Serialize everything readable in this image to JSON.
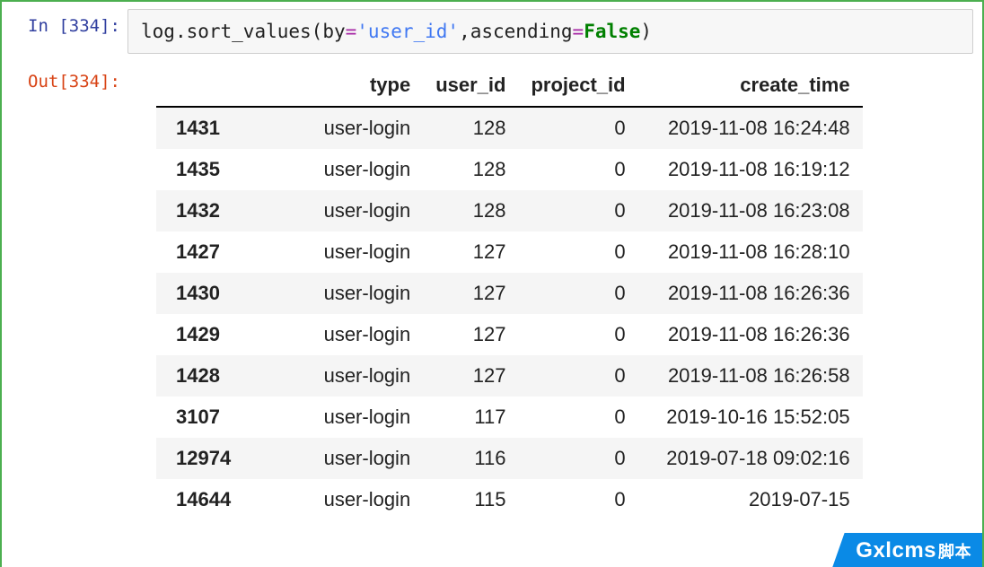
{
  "input": {
    "prompt": "In [334]:",
    "code": {
      "obj": "log",
      "dot1": ".",
      "method": "sort_values",
      "open": "(",
      "kw_by": "by",
      "eq1": "=",
      "str_user": "'user_id'",
      "comma": ",",
      "kw_asc": "ascending",
      "eq2": "=",
      "false": "False",
      "close": ")"
    }
  },
  "output": {
    "prompt": "Out[334]:",
    "columns": {
      "index": "",
      "type": "type",
      "user_id": "user_id",
      "project_id": "project_id",
      "create_time": "create_time"
    },
    "rows": [
      {
        "idx": "1431",
        "type": "user-login",
        "user_id": "128",
        "project_id": "0",
        "create_time": "2019-11-08 16:24:48"
      },
      {
        "idx": "1435",
        "type": "user-login",
        "user_id": "128",
        "project_id": "0",
        "create_time": "2019-11-08 16:19:12"
      },
      {
        "idx": "1432",
        "type": "user-login",
        "user_id": "128",
        "project_id": "0",
        "create_time": "2019-11-08 16:23:08"
      },
      {
        "idx": "1427",
        "type": "user-login",
        "user_id": "127",
        "project_id": "0",
        "create_time": "2019-11-08 16:28:10"
      },
      {
        "idx": "1430",
        "type": "user-login",
        "user_id": "127",
        "project_id": "0",
        "create_time": "2019-11-08 16:26:36"
      },
      {
        "idx": "1429",
        "type": "user-login",
        "user_id": "127",
        "project_id": "0",
        "create_time": "2019-11-08 16:26:36"
      },
      {
        "idx": "1428",
        "type": "user-login",
        "user_id": "127",
        "project_id": "0",
        "create_time": "2019-11-08 16:26:58"
      },
      {
        "idx": "3107",
        "type": "user-login",
        "user_id": "117",
        "project_id": "0",
        "create_time": "2019-10-16 15:52:05"
      },
      {
        "idx": "12974",
        "type": "user-login",
        "user_id": "116",
        "project_id": "0",
        "create_time": "2019-07-18 09:02:16"
      },
      {
        "idx": "14644",
        "type": "user-login",
        "user_id": "115",
        "project_id": "0",
        "create_time": "2019-07-15"
      }
    ]
  },
  "watermark": {
    "brand": "Gxlcms",
    "suffix": "脚本"
  }
}
